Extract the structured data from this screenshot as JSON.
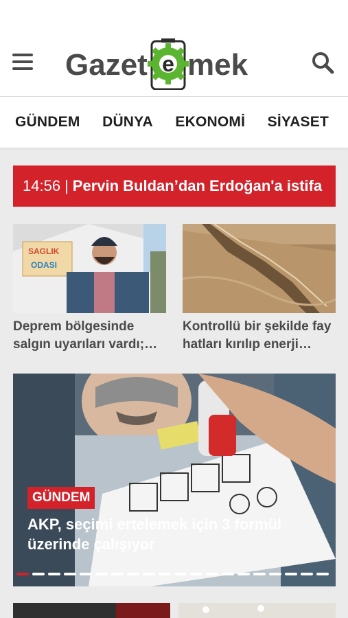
{
  "brand": {
    "logo_text_left": "Gazet",
    "logo_text_mid": "e",
    "logo_text_right": "mek",
    "accent": "#d3222a",
    "logo_green": "#5cb531"
  },
  "nav": {
    "items": [
      "GÜNDEM",
      "DÜNYA",
      "EKONOMİ",
      "SİYASET"
    ]
  },
  "breaking": {
    "time": "14:56",
    "separator": "|",
    "headline": "Pervin Buldan’dan Erdoğan'a istifa"
  },
  "cards": [
    {
      "title": "Deprem bölgesinde salgın uyarıları vardı; yetkililer harekete geçti",
      "image": "tent-man-photo"
    },
    {
      "title": "Kontrollü bir şekilde fay hatları kırılıp enerji boşaltılabilir mi?",
      "image": "fault-line-aerial-photo"
    }
  ],
  "hero": {
    "category": "GÜNDEM",
    "title": "AKP, seçimi ertelemek için 3 formül üzerinde çalışıyor",
    "image": "ballot-stamp-photo",
    "slide_count": 20,
    "active_slide": 1
  },
  "icons": {
    "menu": "hamburger-icon",
    "search": "search-icon"
  }
}
